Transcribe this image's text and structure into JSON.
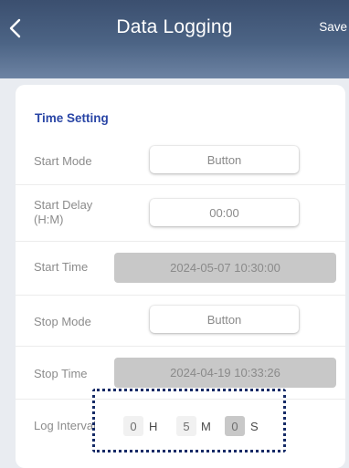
{
  "header": {
    "title": "Data Logging",
    "save_label": "Save"
  },
  "section": {
    "title": "Time Setting"
  },
  "rows": {
    "start_mode": {
      "label": "Start Mode",
      "value": "Button"
    },
    "start_delay": {
      "label_line1": "Start Delay",
      "label_line2": "(H:M)",
      "value": "00:00"
    },
    "start_time": {
      "label": "Start Time",
      "value": "2024-05-07 10:30:00"
    },
    "stop_mode": {
      "label": "Stop Mode",
      "value": "Button"
    },
    "stop_time": {
      "label": "Stop Time",
      "value": "2024-04-19 10:33:26"
    },
    "log_interval": {
      "label": "Log Interval",
      "hours": "0",
      "hours_unit": "H",
      "minutes": "5",
      "minutes_unit": "M",
      "seconds": "0",
      "seconds_unit": "S"
    }
  },
  "colors": {
    "header_bg": "#4c6485",
    "accent": "#2a46a6",
    "annotation": "#152a66"
  },
  "icons": {
    "back": "chevron-left-icon"
  }
}
